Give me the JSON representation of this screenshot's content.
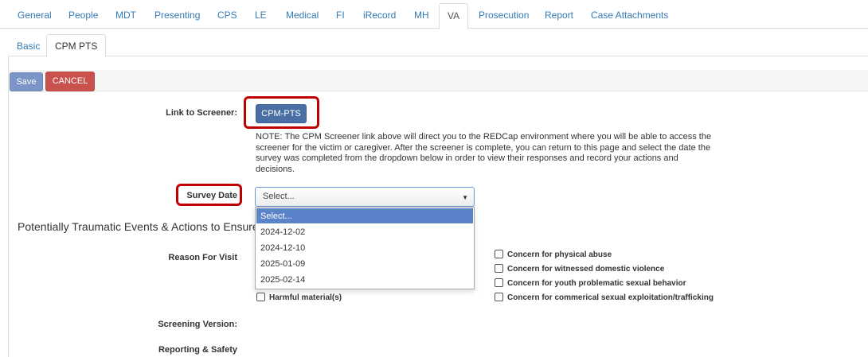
{
  "top_tabs": [
    "General",
    "People",
    "MDT",
    "Presenting",
    "CPS",
    "LE",
    "Medical",
    "FI",
    "iRecord",
    "MH",
    "VA",
    "Prosecution",
    "Report",
    "Case Attachments"
  ],
  "top_tab_active": "VA",
  "sub_tabs": [
    "Basic",
    "CPM PTS"
  ],
  "sub_tab_active": "CPM PTS",
  "toolbar": {
    "save_label": "Save",
    "cancel_label": "CANCEL"
  },
  "screener": {
    "label": "Link to Screener:",
    "button_label": "CPM-PTS",
    "note": "NOTE: The CPM Screener link above will direct you to the REDCap environment where you will be able to access the screener for the victim or caregiver. After the screener is complete, you can return to this page and select the date the survey was completed from the dropdown below in order to view their responses and record your actions and decisions."
  },
  "survey": {
    "label": "Survey Date",
    "selected": "Select...",
    "options": [
      "Select...",
      "2024-12-02",
      "2024-12-10",
      "2025-01-09",
      "2025-02-14"
    ]
  },
  "section_title": "Potentially Traumatic Events & Actions to Ensure S",
  "reason": {
    "label": "Reason For Visit",
    "left_options": [
      {
        "label": "Harmful material(s)",
        "checked": false
      }
    ],
    "right_options": [
      {
        "label": "Concern for physical abuse",
        "checked": false
      },
      {
        "label": "Concern for witnessed domestic violence",
        "checked": false
      },
      {
        "label": "Concern for youth problematic sexual behavior",
        "checked": false
      },
      {
        "label": "Concern for commerical sexual exploitation/trafficking",
        "checked": false
      }
    ]
  },
  "screening_version_label": "Screening Version:",
  "reporting_safety_label": "Reporting & Safety",
  "colors": {
    "link": "#337ab7",
    "callout": "#c00000",
    "save": "#7b95c7",
    "cancel": "#c9524e",
    "primary": "#4a6fa5",
    "selected_option": "#5b83c9"
  }
}
